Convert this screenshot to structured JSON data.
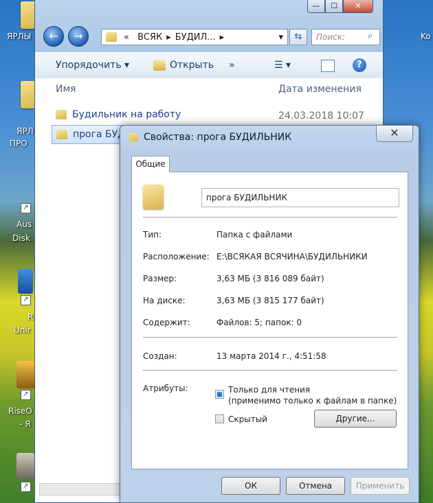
{
  "desktop": {
    "items": [
      {
        "label": "ЯРЛЫ"
      },
      {
        "label": "ЯРЛ"
      },
      {
        "label": "ПРО"
      },
      {
        "label": "Aus"
      },
      {
        "label": "Disk"
      },
      {
        "label": "R"
      },
      {
        "label": "Unir"
      },
      {
        "label": "RiseO"
      },
      {
        "label": "- Я"
      },
      {
        "label": "Ko"
      }
    ]
  },
  "explorer": {
    "window_controls": {
      "minimize": "—",
      "maximize": "☐",
      "close": "✕"
    },
    "address": {
      "prefix": "«",
      "segments": [
        "ВСЯК",
        "БУДИЛ..."
      ]
    },
    "search_placeholder": "Поиск:",
    "toolbar": {
      "organize": "Упорядочить",
      "open": "Открыть",
      "more": "»"
    },
    "columns": {
      "name": "Имя",
      "date": "Дата изменения"
    },
    "files": [
      {
        "name": "Будильник на работу",
        "date": "24.03.2018 10:07"
      },
      {
        "name": "прога БУД",
        "date": ""
      }
    ]
  },
  "dialog": {
    "title": "Свойства: прога БУДИЛЬНИК",
    "close": "✕",
    "tab": "Общие",
    "name_value": "прога БУДИЛЬНИК",
    "props": [
      {
        "label": "Тип:",
        "value": "Папка с файлами"
      },
      {
        "label": "Расположение:",
        "value": "E:\\ВСЯКАЯ ВСЯЧИНА\\БУДИЛЬНИКИ"
      },
      {
        "label": "Размер:",
        "value": "3,63 МБ (3 816 089 байт)"
      },
      {
        "label": "На диске:",
        "value": "3,63 МБ (3 815 177 байт)"
      },
      {
        "label": "Содержит:",
        "value": "Файлов: 5; папок: 0"
      }
    ],
    "created": {
      "label": "Создан:",
      "value": "13 марта 2014 г., 4:51:58"
    },
    "attributes": {
      "label": "Атрибуты:",
      "readonly_line1": "Только для чтения",
      "readonly_line2": "(применимо только к файлам в папке)",
      "hidden": "Скрытый",
      "other_button": "Другие..."
    },
    "buttons": {
      "ok": "ОК",
      "cancel": "Отмена",
      "apply": "Применить"
    }
  }
}
